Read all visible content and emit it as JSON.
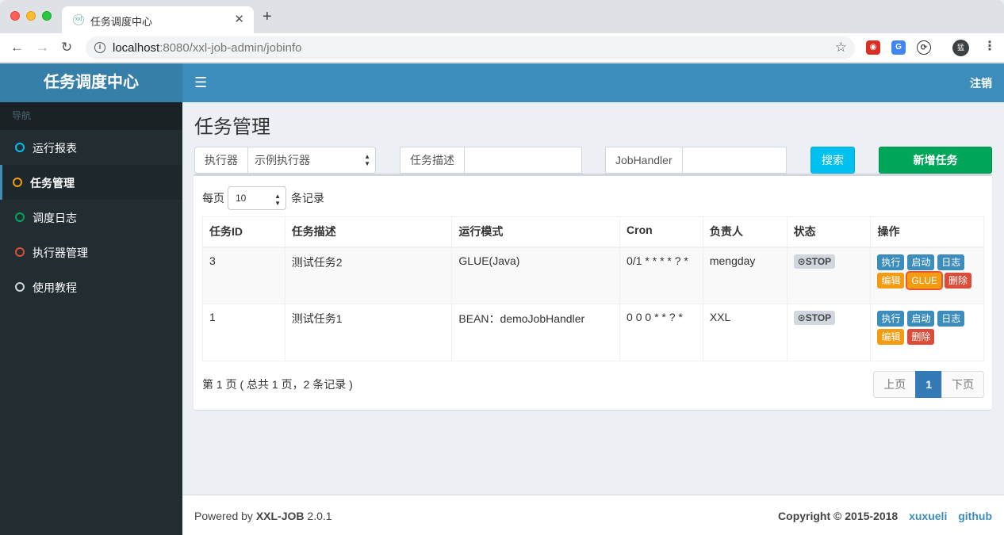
{
  "browser": {
    "tab_title": "任务调度中心",
    "url_host": "localhost",
    "url_rest": ":8080/xxl-job-admin/jobinfo",
    "avatar_initial": "猛"
  },
  "app": {
    "logo": "任务调度中心",
    "logout": "注销",
    "nav_header": "导航",
    "menu": [
      {
        "label": "运行报表",
        "color": "#00c0ef",
        "active": false
      },
      {
        "label": "任务管理",
        "color": "#f39c12",
        "active": true
      },
      {
        "label": "调度日志",
        "color": "#00a65a",
        "active": false
      },
      {
        "label": "执行器管理",
        "color": "#dd4b39",
        "active": false
      },
      {
        "label": "使用教程",
        "color": "#d2d6de",
        "active": false
      }
    ]
  },
  "page": {
    "title": "任务管理",
    "filters": {
      "executor_label": "执行器",
      "executor_value": "示例执行器",
      "desc_label": "任务描述",
      "handler_label": "JobHandler",
      "search_button": "搜索",
      "add_button": "新增任务"
    },
    "length": {
      "prefix": "每页",
      "value": "10",
      "suffix": "条记录"
    },
    "table": {
      "headers": [
        "任务ID",
        "任务描述",
        "运行模式",
        "Cron",
        "负责人",
        "状态",
        "操作"
      ],
      "rows": [
        {
          "id": "3",
          "desc": "测试任务2",
          "mode": "GLUE(Java)",
          "cron": "0/1 * * * * ? *",
          "owner": "mengday",
          "status": "⊙STOP"
        },
        {
          "id": "1",
          "desc": "测试任务1",
          "mode": "BEAN：demoJobHandler",
          "cron": "0 0 0 * * ? *",
          "owner": "XXL",
          "status": "⊙STOP"
        }
      ],
      "ops": {
        "run": "执行",
        "start": "启动",
        "log": "日志",
        "edit": "编辑",
        "glue": "GLUE",
        "delete": "删除"
      }
    },
    "info": "第 1 页 ( 总共 1 页，2 条记录 )",
    "pagination": {
      "prev": "上页",
      "current": "1",
      "next": "下页"
    }
  },
  "footer": {
    "powered_prefix": "Powered by ",
    "product": "XXL-JOB",
    "version": " 2.0.1",
    "copyright": "Copyright © 2015-2018",
    "author_link": "xuxueli",
    "github_link": "github"
  }
}
